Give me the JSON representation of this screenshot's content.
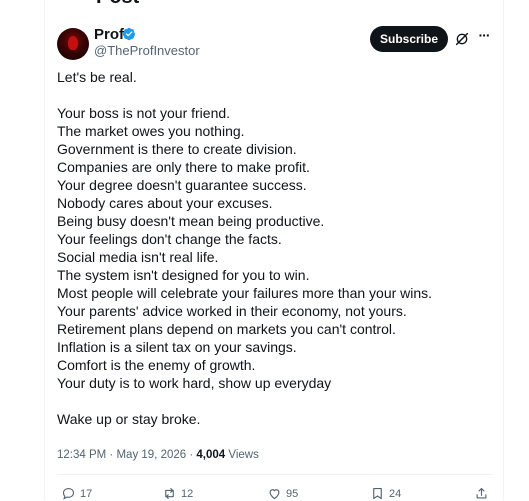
{
  "header": {
    "title": "Post"
  },
  "author": {
    "display_name": "Prof",
    "handle": "@TheProfInvestor"
  },
  "actions_top": {
    "subscribe_label": "Subscribe",
    "more_glyph": "···"
  },
  "post": {
    "intro": "Let's be real.",
    "lines": [
      "Your boss is not your friend.",
      "The market owes you nothing.",
      "Government is there to create division.",
      "Companies are only there to make profit.",
      "Your degree doesn't guarantee success.",
      "Nobody cares about your excuses.",
      "Being busy doesn't mean being productive.",
      "Your feelings don't change the facts.",
      "Social media isn't real life.",
      "The system isn't designed for you to win.",
      "Most people will celebrate your failures more than your wins.",
      "Your parents' advice worked in their economy, not yours.",
      "Retirement plans depend on markets you can't control.",
      "Inflation is a silent tax on your savings.",
      "Comfort is the enemy of growth.",
      "Your duty is to work hard, show up everyday"
    ],
    "outro": "Wake up or stay broke."
  },
  "meta": {
    "time": "12:34 PM",
    "separator": " · ",
    "date": "May 19, 2026",
    "views_count": "4,004",
    "views_label": " Views"
  },
  "engagement": {
    "replies": "17",
    "reposts": "12",
    "likes": "95",
    "bookmarks": "24"
  },
  "colors": {
    "text": "#0f1419",
    "secondary": "#536471",
    "verified": "#1d9bf0",
    "button_bg": "#0f1419"
  },
  "icons": [
    "verified-badge-icon",
    "grok-icon",
    "more-icon",
    "reply-icon",
    "repost-icon",
    "like-icon",
    "bookmark-icon",
    "share-icon"
  ]
}
